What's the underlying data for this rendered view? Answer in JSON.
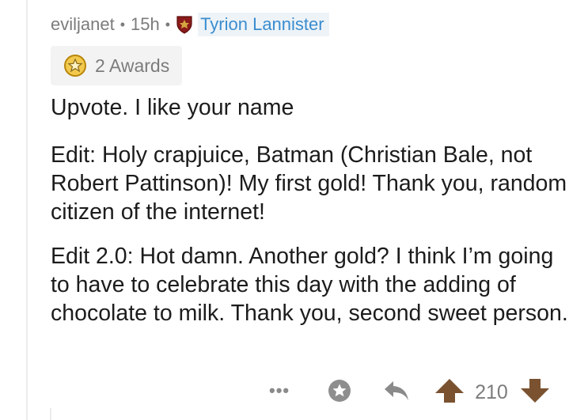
{
  "comment": {
    "username": "eviljanet",
    "separator": "•",
    "age": "15h",
    "flair": "Tyrion Lannister",
    "awards_label": "2 Awards",
    "paragraphs": [
      "Upvote. I like your name",
      "Edit: Holy crapjuice, Batman (Christian Bale, not Robert Pattinson)! My first gold! Thank you, random citizen of the internet!",
      "Edit 2.0: Hot damn. Another gold? I think I’m going to have to celebrate this day with the adding of chocolate to milk. Thank you, second sweet person."
    ]
  },
  "actions": {
    "more_label": "•••",
    "score": "210",
    "icons": [
      "more-icon",
      "award-icon",
      "reply-icon",
      "upvote-icon",
      "downvote-icon"
    ]
  },
  "colors": {
    "meta_text": "#7c7c7c",
    "flair_text": "#3a8dd0",
    "flair_bg": "#eef3f7",
    "award_chip_bg": "#f3f3f3",
    "body_text": "#1c1c1c",
    "action_gray": "#8a8a8a",
    "vote_brown": "#7a5230",
    "flair_shield": "#8b1a1a"
  }
}
